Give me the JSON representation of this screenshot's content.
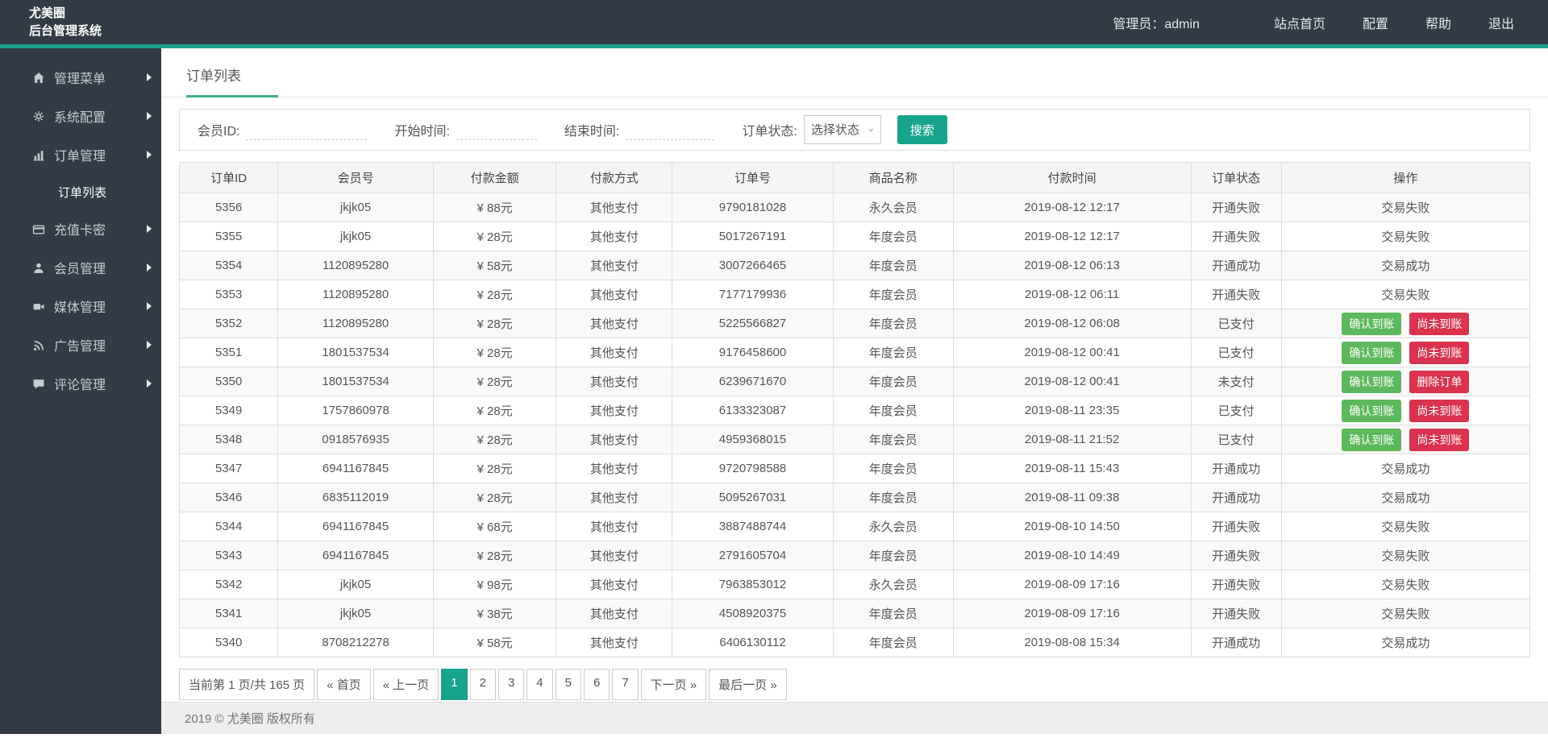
{
  "header": {
    "logo_line1": "尤美圈",
    "logo_line2": "后台管理系统",
    "admin_label": "管理员：admin",
    "links": [
      "站点首页",
      "配置",
      "帮助",
      "退出"
    ]
  },
  "sidebar": {
    "items": [
      {
        "name": "admin-menu",
        "icon": "home-icon",
        "label": "管理菜单"
      },
      {
        "name": "system-config",
        "icon": "gears-icon",
        "label": "系统配置"
      },
      {
        "name": "order-management",
        "icon": "chart-icon",
        "label": "订单管理",
        "children": [
          {
            "name": "order-list",
            "label": "订单列表",
            "active": true
          }
        ]
      },
      {
        "name": "recharge-card",
        "icon": "card-icon",
        "label": "充值卡密"
      },
      {
        "name": "member-management",
        "icon": "user-icon",
        "label": "会员管理"
      },
      {
        "name": "media-management",
        "icon": "video-icon",
        "label": "媒体管理"
      },
      {
        "name": "ad-management",
        "icon": "rss-icon",
        "label": "广告管理"
      },
      {
        "name": "comment-management",
        "icon": "comment-icon",
        "label": "评论管理"
      }
    ]
  },
  "tab": {
    "label": "订单列表"
  },
  "filters": {
    "member_id_label": "会员ID:",
    "start_time_label": "开始时间:",
    "end_time_label": "结束时间:",
    "status_label": "订单状态:",
    "status_selected": "选择状态",
    "search_label": "搜索"
  },
  "table": {
    "headers": [
      "订单ID",
      "会员号",
      "付款金额",
      "付款方式",
      "订单号",
      "商品名称",
      "付款时间",
      "订单状态",
      "操作"
    ],
    "col_widths": [
      "7.3%",
      "11.5%",
      "9.1%",
      "8.6%",
      "11.9%",
      "8.9%",
      "17.6%",
      "6.7%",
      "18.4%"
    ],
    "rows": [
      {
        "order_id": "5356",
        "member": "jkjk05",
        "amount": "¥ 88元",
        "method": "其他支付",
        "order_no": "9790181028",
        "product": "永久会员",
        "pay_time": "2019-08-12 12:17",
        "status": "开通失败",
        "action": {
          "type": "text",
          "label": "交易失败"
        }
      },
      {
        "order_id": "5355",
        "member": "jkjk05",
        "amount": "¥ 28元",
        "method": "其他支付",
        "order_no": "5017267191",
        "product": "年度会员",
        "pay_time": "2019-08-12 12:17",
        "status": "开通失败",
        "action": {
          "type": "text",
          "label": "交易失败"
        }
      },
      {
        "order_id": "5354",
        "member": "1120895280",
        "amount": "¥ 58元",
        "method": "其他支付",
        "order_no": "3007266465",
        "product": "年度会员",
        "pay_time": "2019-08-12 06:13",
        "status": "开通成功",
        "action": {
          "type": "text",
          "label": "交易成功"
        }
      },
      {
        "order_id": "5353",
        "member": "1120895280",
        "amount": "¥ 28元",
        "method": "其他支付",
        "order_no": "7177179936",
        "product": "年度会员",
        "pay_time": "2019-08-12 06:11",
        "status": "开通失败",
        "action": {
          "type": "text",
          "label": "交易失败"
        }
      },
      {
        "order_id": "5352",
        "member": "1120895280",
        "amount": "¥ 28元",
        "method": "其他支付",
        "order_no": "5225566827",
        "product": "年度会员",
        "pay_time": "2019-08-12 06:08",
        "status": "已支付",
        "action": {
          "type": "buttons",
          "buttons": [
            {
              "label": "确认到账",
              "style": "green",
              "name": "confirm-arrival-button"
            },
            {
              "label": "尚未到账",
              "style": "red",
              "name": "not-arrived-button"
            }
          ]
        }
      },
      {
        "order_id": "5351",
        "member": "1801537534",
        "amount": "¥ 28元",
        "method": "其他支付",
        "order_no": "9176458600",
        "product": "年度会员",
        "pay_time": "2019-08-12 00:41",
        "status": "已支付",
        "action": {
          "type": "buttons",
          "buttons": [
            {
              "label": "确认到账",
              "style": "green",
              "name": "confirm-arrival-button"
            },
            {
              "label": "尚未到账",
              "style": "red",
              "name": "not-arrived-button"
            }
          ]
        }
      },
      {
        "order_id": "5350",
        "member": "1801537534",
        "amount": "¥ 28元",
        "method": "其他支付",
        "order_no": "6239671670",
        "product": "年度会员",
        "pay_time": "2019-08-12 00:41",
        "status": "未支付",
        "action": {
          "type": "buttons",
          "buttons": [
            {
              "label": "确认到账",
              "style": "green",
              "name": "confirm-arrival-button"
            },
            {
              "label": "删除订单",
              "style": "red",
              "name": "delete-order-button"
            }
          ]
        }
      },
      {
        "order_id": "5349",
        "member": "1757860978",
        "amount": "¥ 28元",
        "method": "其他支付",
        "order_no": "6133323087",
        "product": "年度会员",
        "pay_time": "2019-08-11 23:35",
        "status": "已支付",
        "action": {
          "type": "buttons",
          "buttons": [
            {
              "label": "确认到账",
              "style": "green",
              "name": "confirm-arrival-button"
            },
            {
              "label": "尚未到账",
              "style": "red",
              "name": "not-arrived-button"
            }
          ]
        }
      },
      {
        "order_id": "5348",
        "member": "0918576935",
        "amount": "¥ 28元",
        "method": "其他支付",
        "order_no": "4959368015",
        "product": "年度会员",
        "pay_time": "2019-08-11 21:52",
        "status": "已支付",
        "action": {
          "type": "buttons",
          "buttons": [
            {
              "label": "确认到账",
              "style": "green",
              "name": "confirm-arrival-button"
            },
            {
              "label": "尚未到账",
              "style": "red",
              "name": "not-arrived-button"
            }
          ]
        }
      },
      {
        "order_id": "5347",
        "member": "6941167845",
        "amount": "¥ 28元",
        "method": "其他支付",
        "order_no": "9720798588",
        "product": "年度会员",
        "pay_time": "2019-08-11 15:43",
        "status": "开通成功",
        "action": {
          "type": "text",
          "label": "交易成功"
        }
      },
      {
        "order_id": "5346",
        "member": "6835112019",
        "amount": "¥ 28元",
        "method": "其他支付",
        "order_no": "5095267031",
        "product": "年度会员",
        "pay_time": "2019-08-11 09:38",
        "status": "开通成功",
        "action": {
          "type": "text",
          "label": "交易成功"
        }
      },
      {
        "order_id": "5344",
        "member": "6941167845",
        "amount": "¥ 68元",
        "method": "其他支付",
        "order_no": "3887488744",
        "product": "永久会员",
        "pay_time": "2019-08-10 14:50",
        "status": "开通失败",
        "action": {
          "type": "text",
          "label": "交易失败"
        }
      },
      {
        "order_id": "5343",
        "member": "6941167845",
        "amount": "¥ 28元",
        "method": "其他支付",
        "order_no": "2791605704",
        "product": "年度会员",
        "pay_time": "2019-08-10 14:49",
        "status": "开通失败",
        "action": {
          "type": "text",
          "label": "交易失败"
        }
      },
      {
        "order_id": "5342",
        "member": "jkjk05",
        "amount": "¥ 98元",
        "method": "其他支付",
        "order_no": "7963853012",
        "product": "永久会员",
        "pay_time": "2019-08-09 17:16",
        "status": "开通失败",
        "action": {
          "type": "text",
          "label": "交易失败"
        }
      },
      {
        "order_id": "5341",
        "member": "jkjk05",
        "amount": "¥ 38元",
        "method": "其他支付",
        "order_no": "4508920375",
        "product": "年度会员",
        "pay_time": "2019-08-09 17:16",
        "status": "开通失败",
        "action": {
          "type": "text",
          "label": "交易失败"
        }
      },
      {
        "order_id": "5340",
        "member": "8708212278",
        "amount": "¥ 58元",
        "method": "其他支付",
        "order_no": "6406130112",
        "product": "年度会员",
        "pay_time": "2019-08-08 15:34",
        "status": "开通成功",
        "action": {
          "type": "text",
          "label": "交易成功"
        }
      }
    ]
  },
  "pagination": {
    "summary": "当前第 1 页/共 165 页",
    "first": "« 首页",
    "prev": "« 上一页",
    "pages": [
      "1",
      "2",
      "3",
      "4",
      "5",
      "6",
      "7"
    ],
    "active_page": "1",
    "next": "下一页 »",
    "last": "最后一页 »"
  },
  "footer": {
    "copyright": "2019 © 尤美圈 版权所有"
  },
  "colors": {
    "header_dark": "#323b46",
    "accent_teal": "#18a38c",
    "tab_underline": "#43b184",
    "action_green": "#5cb85c",
    "action_red": "#d9334f"
  }
}
